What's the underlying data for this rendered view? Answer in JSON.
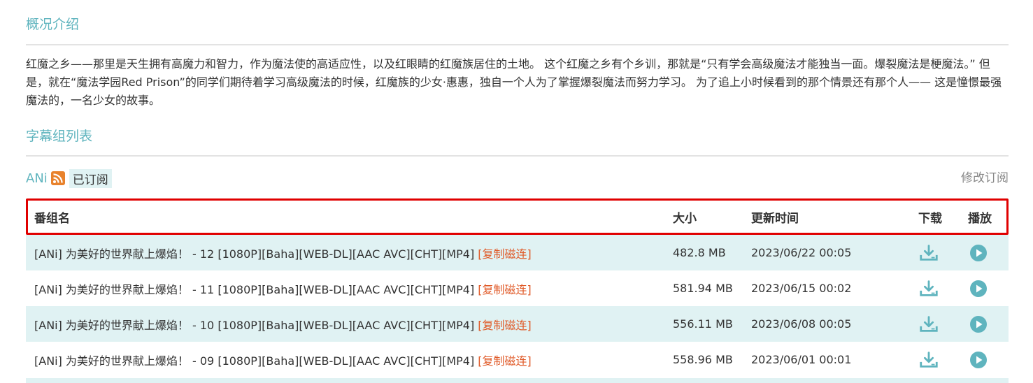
{
  "overview": {
    "title": "概况介绍",
    "text": "红魔之乡——那里是天生拥有高魔力和智力，作为魔法使的高适应性，以及红眼睛的红魔族居住的土地。 这个红魔之乡有个乡训，那就是“只有学会高级魔法才能独当一面。爆裂魔法是梗魔法。” 但是，就在“魔法学园Red Prison”的同学们期待着学习高级魔法的时候，红魔族的少女·惠惠，独自一个人为了掌握爆裂魔法而努力学习。 为了追上小时候看到的那个情景还有那个人—— 这是憧憬最强魔法的，一名少女的故事。"
  },
  "subtitle_groups": {
    "title": "字幕组列表",
    "group_name": "ANi",
    "subscribed_label": "已订阅",
    "edit_subscription_label": "修改订阅",
    "rss_icon": "rss-icon"
  },
  "table": {
    "headers": {
      "name": "番组名",
      "size": "大小",
      "updated": "更新时间",
      "download": "下载",
      "play": "播放"
    },
    "rows": [
      {
        "name": "[ANi] 为美好的世界献上爆焰！ - 12 [1080P][Baha][WEB-DL][AAC AVC][CHT][MP4]",
        "magnet": "[复制磁连]",
        "size": "482.8 MB",
        "time": "2023/06/22 00:05"
      },
      {
        "name": "[ANi] 为美好的世界献上爆焰！ - 11 [1080P][Baha][WEB-DL][AAC AVC][CHT][MP4]",
        "magnet": "[复制磁连]",
        "size": "581.94 MB",
        "time": "2023/06/15 00:02"
      },
      {
        "name": "[ANi] 为美好的世界献上爆焰！ - 10 [1080P][Baha][WEB-DL][AAC AVC][CHT][MP4]",
        "magnet": "[复制磁连]",
        "size": "556.11 MB",
        "time": "2023/06/08 00:05"
      },
      {
        "name": "[ANi] 为美好的世界献上爆焰！ - 09 [1080P][Baha][WEB-DL][AAC AVC][CHT][MP4]",
        "magnet": "[复制磁连]",
        "size": "558.96 MB",
        "time": "2023/06/01 00:01"
      }
    ]
  },
  "colors": {
    "accent": "#5fb4be",
    "row_alt": "#e0f2f3",
    "magnet": "#e05a28",
    "highlight_border": "#e00000",
    "rss": "#e8822c"
  }
}
